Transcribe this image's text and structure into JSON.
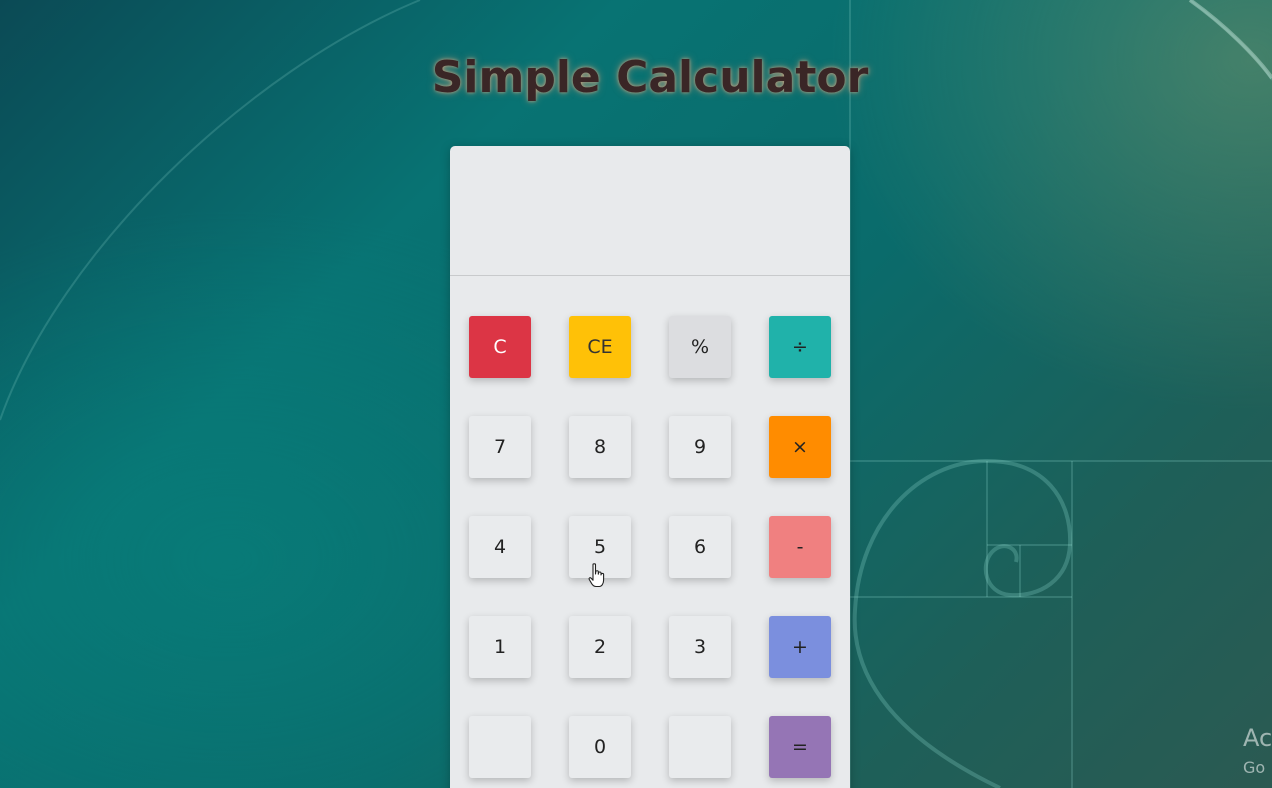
{
  "page": {
    "title": "Simple Calculator"
  },
  "display": {
    "value": ""
  },
  "keys": {
    "clear": {
      "label": "C",
      "color": "#dc3545"
    },
    "clear_entry": {
      "label": "CE",
      "color": "#ffc107"
    },
    "percent": {
      "label": "%",
      "color": "#dcdde0"
    },
    "divide": {
      "label": "÷",
      "color": "#20b2aa"
    },
    "seven": {
      "label": "7"
    },
    "eight": {
      "label": "8"
    },
    "nine": {
      "label": "9"
    },
    "multiply": {
      "label": "×",
      "color": "#ff8c00"
    },
    "four": {
      "label": "4"
    },
    "five": {
      "label": "5"
    },
    "six": {
      "label": "6"
    },
    "subtract": {
      "label": "-",
      "color": "#f08080"
    },
    "one": {
      "label": "1"
    },
    "two": {
      "label": "2"
    },
    "three": {
      "label": "3"
    },
    "add": {
      "label": "+",
      "color": "#7b8fde"
    },
    "blank_left": {
      "label": ""
    },
    "zero": {
      "label": "0"
    },
    "blank_right": {
      "label": ""
    },
    "equals": {
      "label": "=",
      "color": "#9575b5"
    }
  },
  "watermark": {
    "line1": "Ac",
    "line2": "Go"
  },
  "icons": {
    "cursor": "hand-pointer-icon"
  }
}
